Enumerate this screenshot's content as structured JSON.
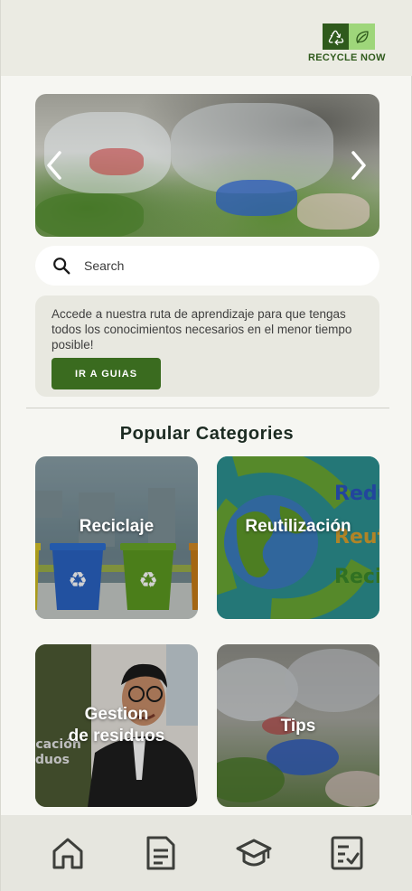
{
  "brand": {
    "name": "RECYCLE NOW",
    "colors": {
      "dark": "#2f5a1c",
      "light": "#9ed67a"
    },
    "icons": [
      "recycle-icon",
      "leaf-icon"
    ]
  },
  "carousel": {
    "image": "plastic-waste-on-grass",
    "prev_icon": "chevron-left-icon",
    "next_icon": "chevron-right-icon"
  },
  "search": {
    "placeholder": "Search",
    "icon": "search-icon"
  },
  "info_card": {
    "text": "Accede a nuestra ruta de aprendizaje para que tengas todos los conocimientos necesarios en el menor tiempo posible!",
    "button_label": "IR A GUIAS"
  },
  "categories": {
    "title": "Popular Categories",
    "items": [
      {
        "label": "Reciclaje"
      },
      {
        "label": "Reutilización"
      },
      {
        "label_line1": "Gestion",
        "label_line2": "de residuos",
        "bg_text_1": "ficación",
        "bg_text_2": "duos"
      },
      {
        "label": "Tips"
      }
    ],
    "reutil_bg_words": [
      "Reduc",
      "Reutil",
      "Recic"
    ]
  },
  "bottom_nav": {
    "items": [
      {
        "icon": "home-icon"
      },
      {
        "icon": "document-icon"
      },
      {
        "icon": "graduation-cap-icon"
      },
      {
        "icon": "checklist-icon"
      }
    ]
  },
  "accent_color": "#3a6b1f"
}
